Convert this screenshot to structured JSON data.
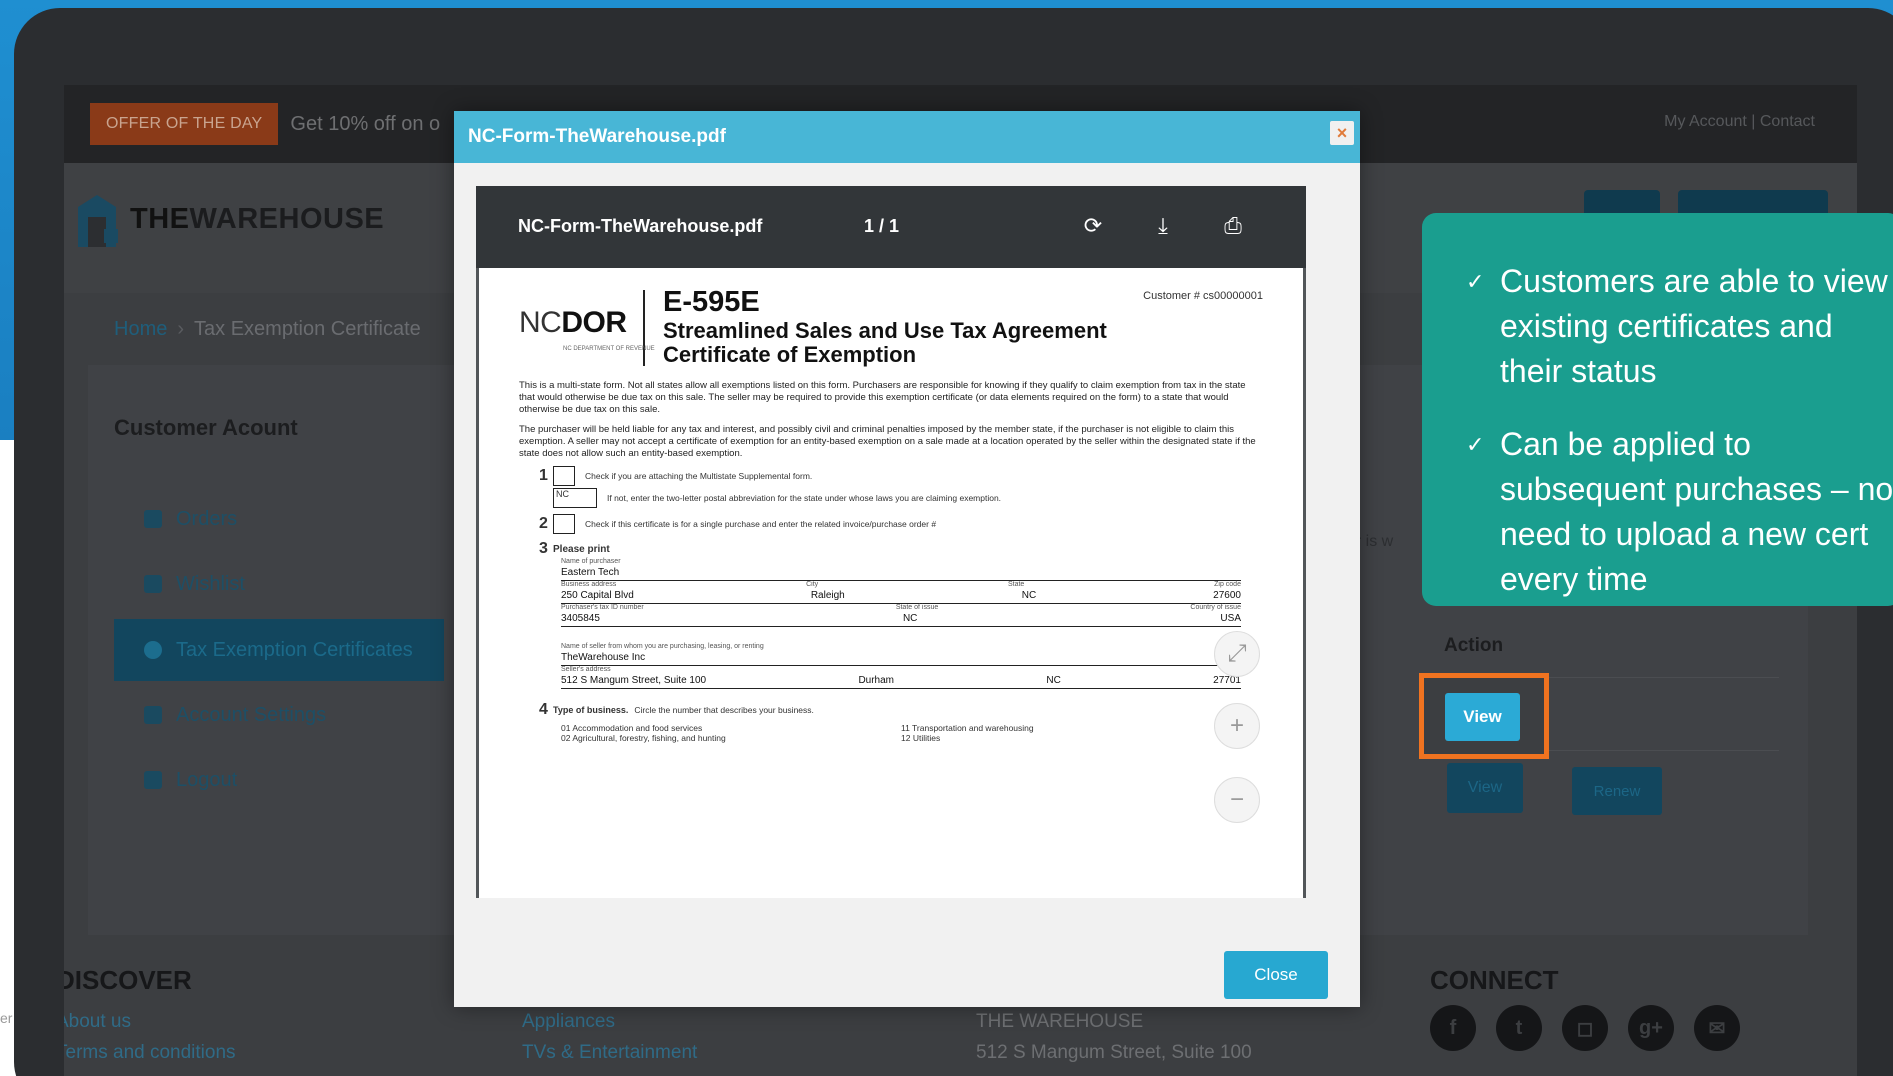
{
  "topbar": {
    "offer_badge": "OFFER OF THE DAY",
    "offer_text": "Get 10% off on o",
    "links": "My Account  |  Contact"
  },
  "header": {
    "logo_text_a": "THE",
    "logo_text_b": "WAREHOUSE"
  },
  "breadcrumb": {
    "home": "Home",
    "sep": "›",
    "current": "Tax Exemption Certificate"
  },
  "sidebar": {
    "title": "Customer Acount",
    "items": [
      {
        "label": "Orders"
      },
      {
        "label": "Wishlist"
      },
      {
        "label": "Tax Exemption Certificates"
      },
      {
        "label": "Account Settings"
      },
      {
        "label": "Logout"
      }
    ]
  },
  "table": {
    "hint": "er is w",
    "action_header": "Action",
    "view_label": "View",
    "renew_label": "Renew"
  },
  "footer": {
    "discover": "DISCOVER",
    "discover_links": [
      "About us",
      "Terms and conditions"
    ],
    "categories": [
      "Appliances",
      "TVs & Entertainment"
    ],
    "company": "THE WAREHOUSE",
    "address": "512 S Mangum Street, Suite 100",
    "connect": "CONNECT",
    "left_cut": "er"
  },
  "modal": {
    "title": "NC-Form-TheWarehouse.pdf",
    "close_x": "×",
    "close_button": "Close",
    "pdf": {
      "filename": "NC-Form-TheWarehouse.pdf",
      "pages": "1 / 1",
      "rotate_icon": "⟳",
      "download_icon": "⤓",
      "print_icon": "⎙",
      "logo_nc": "NC",
      "logo_dor": "DOR",
      "logo_sub": "NC DEPARTMENT OF REVENUE",
      "customer_no": "Customer #  cs00000001",
      "form_id": "E-595E",
      "title_line1": "Streamlined Sales and Use Tax Agreement",
      "title_line2": "Certificate of Exemption",
      "para1": "This is a multi-state form. Not all states allow all exemptions listed on this form. Purchasers are responsible for knowing if they qualify to claim exemption from tax in the state that would otherwise be due tax on this sale. The seller may be required to provide this exemption certificate (or data elements required on the form) to a state that would otherwise be due tax on this sale.",
      "para2": "The purchaser will be held liable for any tax and interest, and possibly civil and criminal penalties imposed by the member state, if the purchaser is not eligible to claim this exemption. A seller may not accept a certificate of exemption for an entity-based exemption on a sale made at a location operated by the seller within the designated state if the state does not allow such an entity-based exemption.",
      "step1_text": "Check if you are attaching the Multistate Supplemental form.",
      "step1b_state": "NC",
      "step1b_text": "If not, enter the two-letter postal abbreviation for the state under whose laws you are claiming exemption.",
      "step2_text": "Check if this certificate is for a single purchase and enter the related invoice/purchase order #",
      "step3_heading": "Please print",
      "purchaser_name_lbl": "Name of purchaser",
      "purchaser_name": "Eastern Tech",
      "address_lbl": "Business address",
      "address": "250 Capital Blvd",
      "city": "Raleigh",
      "state": "NC",
      "zip": "27600",
      "city_lbl": "City",
      "state_lbl": "State",
      "zip_lbl": "Zip code",
      "taxid_lbl": "Purchaser's tax ID number",
      "taxid": "3405845",
      "issue_state": "NC",
      "country": "USA",
      "issue_state_lbl": "State of issue",
      "country_lbl": "Country of issue",
      "seller_lbl": "Name of seller from whom you are purchasing, leasing, or renting",
      "seller": "TheWarehouse Inc",
      "seller_addr_lbl": "Seller's address",
      "seller_addr": "512 S Mangum Street, Suite 100",
      "seller_city": "Durham",
      "seller_state": "NC",
      "seller_zip": "27701",
      "step4_heading": "Type of business.",
      "step4_text": "Circle the number that describes your business.",
      "biz_01": "01  Accommodation and food services",
      "biz_02": "02  Agricultural, forestry, fishing, and hunting",
      "biz_11": "11  Transportation and warehousing",
      "biz_12": "12  Utilities",
      "zoom_fit": "⤢",
      "zoom_in": "+",
      "zoom_out": "−",
      "num1": "1",
      "num2": "2",
      "num3": "3",
      "num4": "4"
    }
  },
  "callout": {
    "check_icon": "✓",
    "items": [
      "Customers are able to view existing certificates and their status",
      "Can be applied to subsequent purchases – no need to upload a new cert every time"
    ]
  },
  "colors": {
    "callout_bg": "#1a9e8f",
    "modal_header": "#48b6d6",
    "highlight": "#f07320",
    "view_button": "#2baad6",
    "background_blue": "#1f8fd1"
  }
}
